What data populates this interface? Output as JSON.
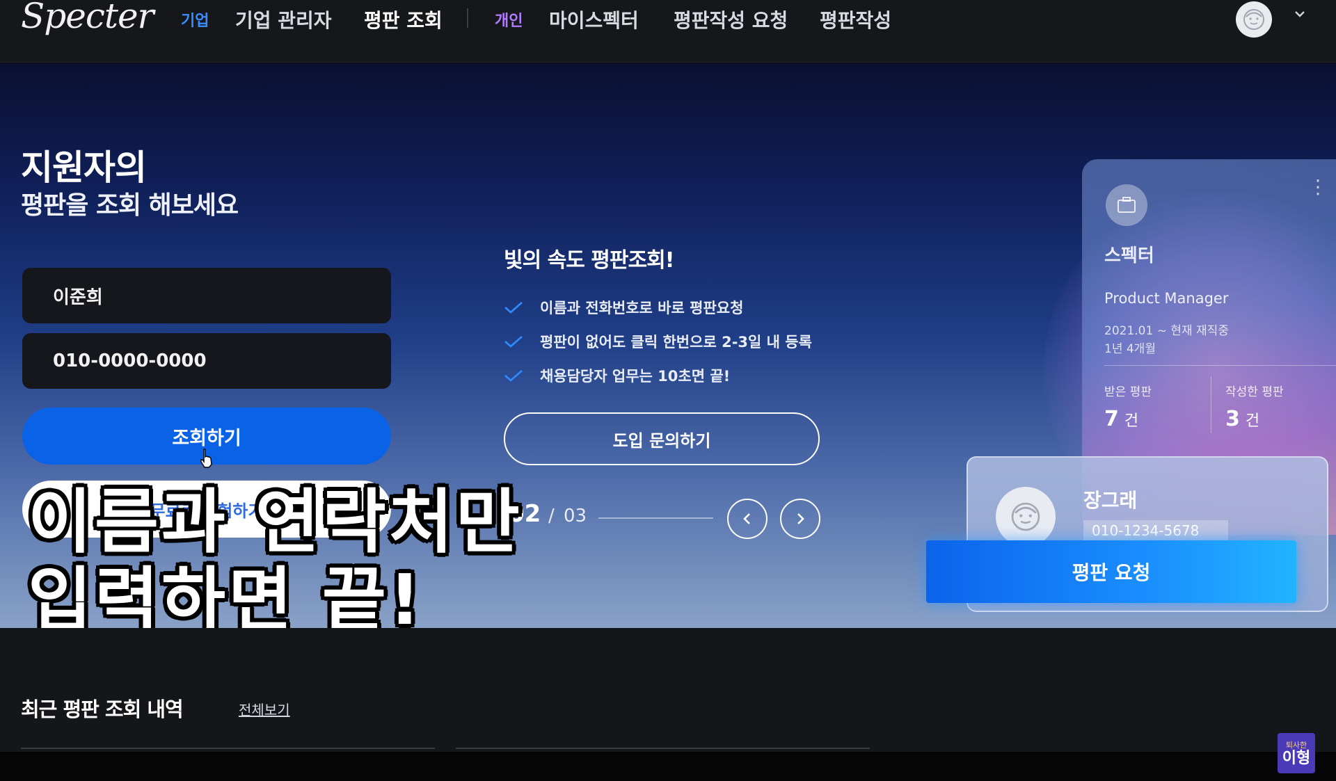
{
  "nav": {
    "logo": "Specter",
    "tag_company": "기업",
    "company_admin": "기업 관리자",
    "reputation_lookup": "평판 조회",
    "tag_personal": "개인",
    "my_specter": "마이스펙터",
    "request_reputation": "평판작성 요청",
    "write_reputation": "평판작성",
    "colors": {
      "tag_company": "#3a8dff",
      "tag_personal": "#b07cff",
      "bg": "#16171b"
    }
  },
  "hero": {
    "title_line1": "지원자의",
    "title_line2": "평판을 조회 해보세요",
    "name_value": "이준희",
    "phone_value": "010-0000-0000",
    "search_button": "조회하기",
    "secondary_button": "무료로 체험하기",
    "feature_title": "빛의 속도 평판조회!",
    "features": [
      "이름과 전화번호로 바로 평판요청",
      "평판이 없어도 클릭 한번으로 2-3일 내 등록",
      "채용담당자 업무는 10초면 끝!"
    ],
    "inquiry_button": "도입 문의하기",
    "pager": {
      "current": "02",
      "slash": "/",
      "total": "03"
    },
    "colors": {
      "accent": "#0a63e6",
      "check": "#2f8cff"
    }
  },
  "profile_card": {
    "company": "스펙터",
    "role": "Product Manager",
    "period": "2021.01 ~ 현재 재직중",
    "duration": "1년 4개월",
    "received_label": "받은 평판",
    "received_value": "7",
    "written_label": "작성한 평판",
    "written_value": "3",
    "unit": "건"
  },
  "candidate_card": {
    "name": "장그래",
    "phone": "010-1234-5678",
    "request_button": "평판 요청"
  },
  "subtitle": {
    "line1": "이름과 연락처만",
    "line2": "입력하면 끝!"
  },
  "recent": {
    "title": "최근 평판 조회 내역",
    "view_all": "전체보기"
  },
  "watermark": {
    "line1": "퇴사한",
    "line2": "이형"
  }
}
